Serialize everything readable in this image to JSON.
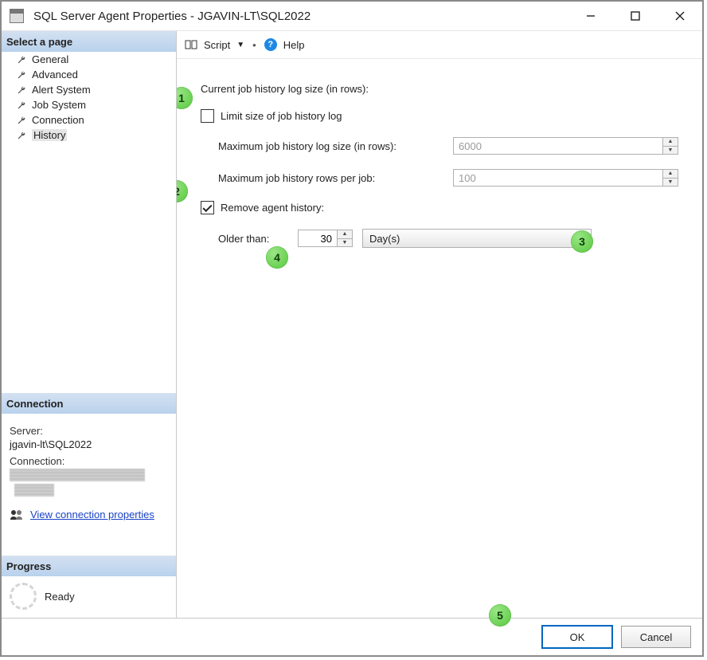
{
  "window": {
    "title": "SQL Server Agent Properties - JGAVIN-LT\\SQL2022"
  },
  "sidebar": {
    "select_a_page": "Select a page",
    "pages": [
      {
        "label": "General",
        "selected": false
      },
      {
        "label": "Advanced",
        "selected": false
      },
      {
        "label": "Alert System",
        "selected": false
      },
      {
        "label": "Job System",
        "selected": false
      },
      {
        "label": "Connection",
        "selected": false
      },
      {
        "label": "History",
        "selected": true
      }
    ],
    "connection_header": "Connection",
    "server_label": "Server:",
    "server_value": "jgavin-lt\\SQL2022",
    "connection_label": "Connection:",
    "view_conn_props": "View connection properties",
    "progress_header": "Progress",
    "progress_status": "Ready"
  },
  "toolbar": {
    "script_label": "Script",
    "help_label": "Help"
  },
  "form": {
    "section1_title": "Current job history log size (in rows):",
    "limit_label": "Limit size of job history log",
    "limit_checked": false,
    "max_log_label": "Maximum job history log size (in rows):",
    "max_log_value": "6000",
    "max_per_job_label": "Maximum job history rows per job:",
    "max_per_job_value": "100",
    "remove_label": "Remove agent history:",
    "remove_checked": true,
    "older_than_label": "Older than:",
    "older_than_value": "30",
    "older_than_unit": "Day(s)"
  },
  "buttons": {
    "ok": "OK",
    "cancel": "Cancel"
  },
  "annotations": {
    "1": "1",
    "2": "2",
    "3": "3",
    "4": "4",
    "5": "5"
  }
}
